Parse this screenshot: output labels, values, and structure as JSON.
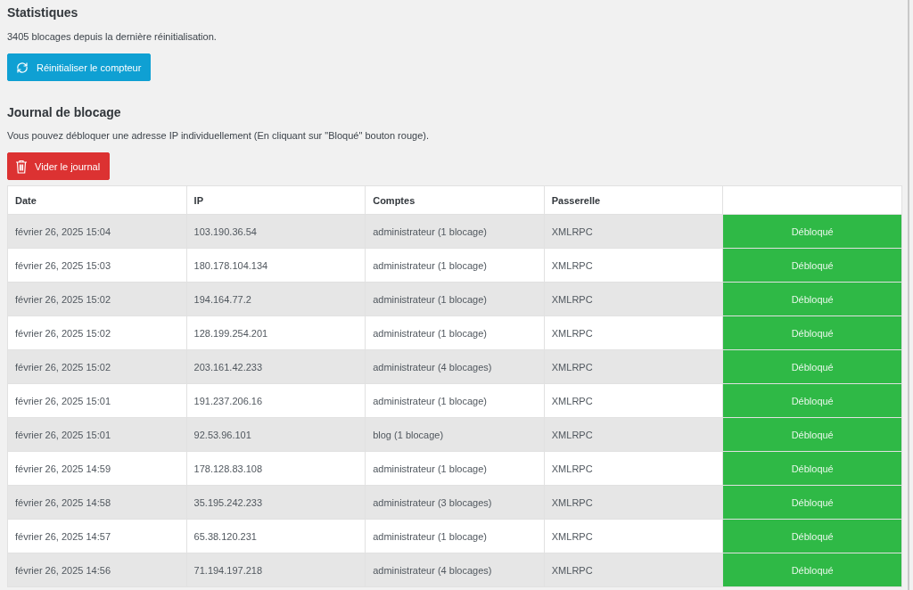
{
  "statistics": {
    "title": "Statistiques",
    "summary": "3405 blocages depuis la dernière réinitialisation.",
    "reset_button": "Réinitialiser le compteur"
  },
  "log": {
    "title": "Journal de blocage",
    "description": "Vous pouvez débloquer une adresse IP individuellement (En cliquant sur \"Bloqué\" bouton rouge).",
    "clear_button": "Vider le journal"
  },
  "table": {
    "columns": [
      "Date",
      "IP",
      "Comptes",
      "Passerelle"
    ],
    "rows": [
      {
        "date": "février 26, 2025 15:04",
        "ip": "103.190.36.54",
        "accounts": "administrateur (1 blocage)",
        "gateway": "XMLRPC",
        "status": "Débloqué",
        "blocked": false
      },
      {
        "date": "février 26, 2025 15:03",
        "ip": "180.178.104.134",
        "accounts": "administrateur (1 blocage)",
        "gateway": "XMLRPC",
        "status": "Débloqué",
        "blocked": false
      },
      {
        "date": "février 26, 2025 15:02",
        "ip": "194.164.77.2",
        "accounts": "administrateur (1 blocage)",
        "gateway": "XMLRPC",
        "status": "Débloqué",
        "blocked": false
      },
      {
        "date": "février 26, 2025 15:02",
        "ip": "128.199.254.201",
        "accounts": "administrateur (1 blocage)",
        "gateway": "XMLRPC",
        "status": "Débloqué",
        "blocked": false
      },
      {
        "date": "février 26, 2025 15:02",
        "ip": "203.161.42.233",
        "accounts": "administrateur (4 blocages)",
        "gateway": "XMLRPC",
        "status": "Débloqué",
        "blocked": false
      },
      {
        "date": "février 26, 2025 15:01",
        "ip": "191.237.206.16",
        "accounts": "administrateur (1 blocage)",
        "gateway": "XMLRPC",
        "status": "Débloqué",
        "blocked": false
      },
      {
        "date": "février 26, 2025 15:01",
        "ip": "92.53.96.101",
        "accounts": "blog (1 blocage)",
        "gateway": "XMLRPC",
        "status": "Débloqué",
        "blocked": false
      },
      {
        "date": "février 26, 2025 14:59",
        "ip": "178.128.83.108",
        "accounts": "administrateur (1 blocage)",
        "gateway": "XMLRPC",
        "status": "Débloqué",
        "blocked": false
      },
      {
        "date": "février 26, 2025 14:58",
        "ip": "35.195.242.233",
        "accounts": "administrateur (3 blocages)",
        "gateway": "XMLRPC",
        "status": "Débloqué",
        "blocked": false
      },
      {
        "date": "février 26, 2025 14:57",
        "ip": "65.38.120.231",
        "accounts": "administrateur (1 blocage)",
        "gateway": "XMLRPC",
        "status": "Débloqué",
        "blocked": false
      },
      {
        "date": "février 26, 2025 14:56",
        "ip": "71.194.197.218",
        "accounts": "administrateur (4 blocages)",
        "gateway": "XMLRPC",
        "status": "Débloqué",
        "blocked": false
      }
    ]
  }
}
